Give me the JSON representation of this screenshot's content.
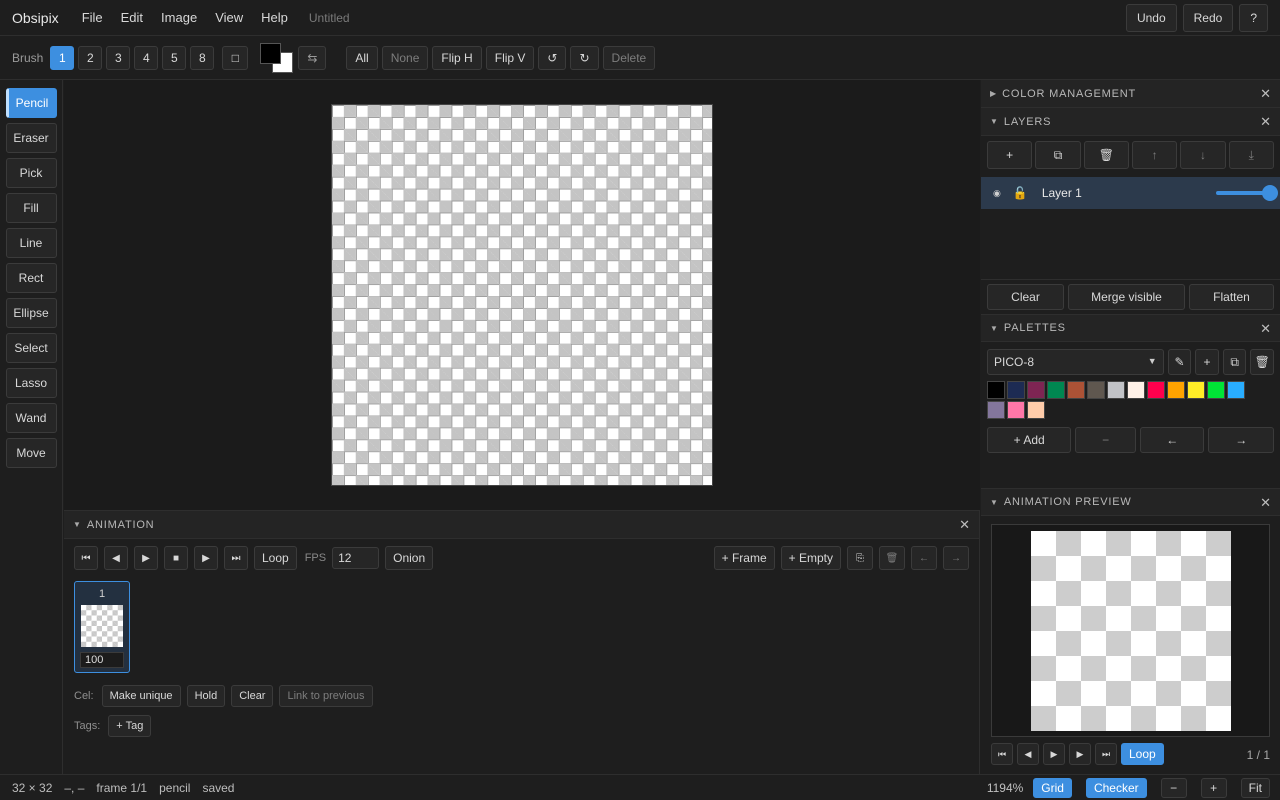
{
  "menubar": {
    "app_title": "Obsipix",
    "menus": [
      "File",
      "Edit",
      "Image",
      "View",
      "Help"
    ],
    "document_title": "Untitled",
    "undo_label": "Undo",
    "redo_label": "Redo",
    "help_label": "?"
  },
  "toolbar": {
    "brush_label": "Brush",
    "brush_sizes": [
      "1",
      "2",
      "3",
      "4",
      "5",
      "8"
    ],
    "active_brush_size": "1",
    "pixel_perfect_icon": "□",
    "fg_color": "#000000",
    "bg_color": "#ffffff",
    "swap_icon": "⇆",
    "select_all_label": "All",
    "select_none_label": "None",
    "flip_h_label": "Flip H",
    "flip_v_label": "Flip V",
    "rotate_ccw_icon": "↺",
    "rotate_cw_icon": "↻",
    "delete_label": "Delete"
  },
  "tools": {
    "active": "Pencil",
    "items": [
      "Pencil",
      "Eraser",
      "Pick",
      "Fill",
      "Line",
      "Rect",
      "Ellipse",
      "Select",
      "Lasso",
      "Wand",
      "Move"
    ]
  },
  "animation": {
    "title": "ANIMATION",
    "close_icon": "✕",
    "first_icon": "⏮",
    "prev_icon": "◀",
    "play_icon": "▶",
    "stop_icon": "■",
    "next_icon": "▶",
    "last_icon": "⏭",
    "loop_label": "Loop",
    "fps_label": "FPS",
    "fps_value": "12",
    "onion_label": "Onion",
    "add_frame_label": "+ Frame",
    "add_empty_label": "+ Empty",
    "duplicate_icon": "⎘",
    "delete_icon": "🗑",
    "move_left_icon": "←",
    "move_right_icon": "→",
    "frames": [
      {
        "number": "1",
        "duration": "100"
      }
    ],
    "cel_label": "Cel:",
    "make_unique_label": "Make unique",
    "hold_label": "Hold",
    "clear_label": "Clear",
    "link_previous_label": "Link to previous",
    "tags_label": "Tags:",
    "add_tag_label": "+ Tag"
  },
  "color_management": {
    "title": "COLOR MANAGEMENT",
    "close_icon": "✕"
  },
  "layers": {
    "title": "LAYERS",
    "close_icon": "✕",
    "add_icon": "+",
    "duplicate_icon": "⧉",
    "delete_icon": "🗑",
    "move_up_icon": "↑",
    "move_down_icon": "↓",
    "merge_down_icon": "⤓",
    "items": [
      {
        "name": "Layer 1",
        "visible_icon": "◉",
        "lock_icon": "🔓",
        "opacity": 1.0
      }
    ],
    "clear_label": "Clear",
    "merge_visible_label": "Merge visible",
    "flatten_label": "Flatten"
  },
  "palettes": {
    "title": "PALETTES",
    "close_icon": "✕",
    "selected": "PICO-8",
    "edit_icon": "✎",
    "add_icon": "+",
    "duplicate_icon": "⧉",
    "delete_icon": "🗑",
    "colors": [
      "#000000",
      "#1d2b53",
      "#7e2553",
      "#008751",
      "#ab5236",
      "#5f574f",
      "#c2c3c7",
      "#fff1e8",
      "#ff004d",
      "#ffa300",
      "#ffec27",
      "#00e436",
      "#29adff",
      "#83769c",
      "#ff77a8",
      "#ffccaa"
    ],
    "add_color_label": "+ Add",
    "remove_color_label": "−",
    "move_left_label": "←",
    "move_right_label": "→"
  },
  "preview": {
    "title": "ANIMATION PREVIEW",
    "close_icon": "✕",
    "first_icon": "⏮",
    "prev_icon": "◀",
    "play_icon": "▶",
    "next_icon": "▶",
    "last_icon": "⏭",
    "loop_label": "Loop",
    "counter": "1 / 1"
  },
  "status": {
    "canvas_size": "32 × 32",
    "cursor_position": "–, –",
    "frame": "frame 1/1",
    "tool": "pencil",
    "save_state": "saved",
    "zoom": "1194%",
    "grid_label": "Grid",
    "checker_label": "Checker",
    "zoom_out_label": "−",
    "zoom_in_label": "+",
    "fit_label": "Fit"
  }
}
